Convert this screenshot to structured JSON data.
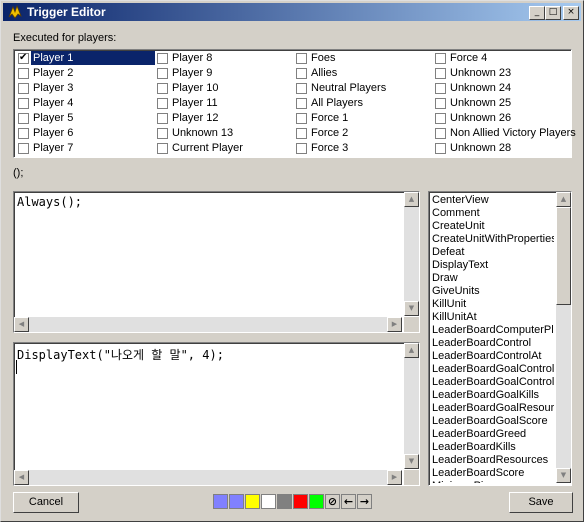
{
  "window": {
    "title": "Trigger Editor"
  },
  "players_label": "Executed for players:",
  "players": [
    {
      "label": "Player 1",
      "checked": true,
      "selected": true
    },
    {
      "label": "Player 2",
      "checked": false
    },
    {
      "label": "Player 3",
      "checked": false
    },
    {
      "label": "Player 4",
      "checked": false
    },
    {
      "label": "Player 5",
      "checked": false
    },
    {
      "label": "Player 6",
      "checked": false
    },
    {
      "label": "Player 7",
      "checked": false
    },
    {
      "label": "Player 8",
      "checked": false
    },
    {
      "label": "Player 9",
      "checked": false
    },
    {
      "label": "Player 10",
      "checked": false
    },
    {
      "label": "Player 11",
      "checked": false
    },
    {
      "label": "Player 12",
      "checked": false
    },
    {
      "label": "Unknown 13",
      "checked": false
    },
    {
      "label": "Current Player",
      "checked": false
    },
    {
      "label": "Foes",
      "checked": false
    },
    {
      "label": "Allies",
      "checked": false
    },
    {
      "label": "Neutral Players",
      "checked": false
    },
    {
      "label": "All Players",
      "checked": false
    },
    {
      "label": "Force 1",
      "checked": false
    },
    {
      "label": "Force 2",
      "checked": false
    },
    {
      "label": "Force 3",
      "checked": false
    },
    {
      "label": "Force 4",
      "checked": false
    },
    {
      "label": "Unknown 23",
      "checked": false
    },
    {
      "label": "Unknown 24",
      "checked": false
    },
    {
      "label": "Unknown 25",
      "checked": false
    },
    {
      "label": "Unknown 26",
      "checked": false
    },
    {
      "label": "Non Allied Victory Players",
      "checked": false
    },
    {
      "label": "Unknown 28",
      "checked": false
    }
  ],
  "signature": "();",
  "conditions_text": "Always();",
  "actions_text": "DisplayText(\"나오게 할 말\", 4);",
  "functions": [
    "CenterView",
    "Comment",
    "CreateUnit",
    "CreateUnitWithProperties",
    "Defeat",
    "DisplayText",
    "Draw",
    "GiveUnits",
    "KillUnit",
    "KillUnitAt",
    "LeaderBoardComputerPlayers",
    "LeaderBoardControl",
    "LeaderBoardControlAt",
    "LeaderBoardGoalControl",
    "LeaderBoardGoalControlAt",
    "LeaderBoardGoalKills",
    "LeaderBoardGoalResources",
    "LeaderBoardGoalScore",
    "LeaderBoardGreed",
    "LeaderBoardKills",
    "LeaderBoardResources",
    "LeaderBoardScore",
    "MinimapPing"
  ],
  "buttons": {
    "cancel": "Cancel",
    "save": "Save"
  },
  "color_swatches": [
    "#8080ff",
    "#8080ff",
    "#ffff00",
    "#ffffff",
    "#808080",
    "#ff0000",
    "#00ff00"
  ],
  "title_buttons": {
    "minimize": "_",
    "maximize": "□",
    "close": "×"
  }
}
